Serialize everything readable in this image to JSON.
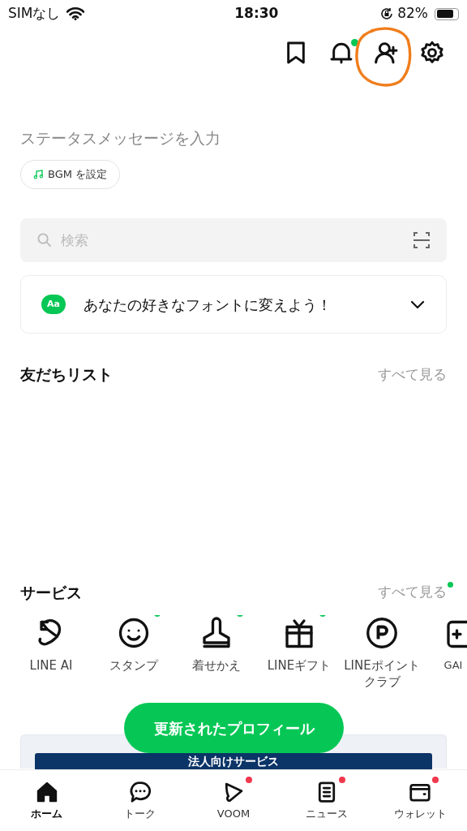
{
  "status_bar": {
    "carrier": "SIMなし",
    "time": "18:30",
    "battery": "82%"
  },
  "header_icons": [
    {
      "kind": "bookmark",
      "badge": false,
      "highlighted": false
    },
    {
      "kind": "bell",
      "badge": true,
      "highlighted": false
    },
    {
      "kind": "add-friend",
      "badge": false,
      "highlighted": true
    },
    {
      "kind": "settings",
      "badge": false,
      "highlighted": false
    }
  ],
  "profile": {
    "status_message_placeholder": "ステータスメッセージを入力",
    "bgm_button": "BGM を設定"
  },
  "search": {
    "placeholder": "検索"
  },
  "font_banner": {
    "icon_text": "Aa",
    "text": "あなたの好きなフォントに変えよう！",
    "expanded": false
  },
  "friends": {
    "title": "友だちリスト",
    "see_all": "すべて見る"
  },
  "services": {
    "title": "サービス",
    "see_all": "すべて見る",
    "see_all_badge": true,
    "items": [
      {
        "kind": "ai",
        "label": "LINE AI",
        "badge": false
      },
      {
        "kind": "sticker",
        "label": "スタンプ",
        "badge": true
      },
      {
        "kind": "theme",
        "label": "着せかえ",
        "badge": true
      },
      {
        "kind": "gift",
        "label": "LINEギフト",
        "badge": true
      },
      {
        "kind": "points",
        "label": "LINEポイントクラブ",
        "badge": false
      },
      {
        "kind": "games",
        "label": "GAI",
        "badge": false
      }
    ]
  },
  "floating_button": "更新されたプロフィール",
  "promo_banner": {
    "text": "法人向けサービス"
  },
  "tab_bar": [
    {
      "kind": "home",
      "label": "ホーム",
      "selected": true,
      "badge": false
    },
    {
      "kind": "talk",
      "label": "トーク",
      "selected": false,
      "badge": false
    },
    {
      "kind": "voom",
      "label": "VOOM",
      "selected": false,
      "badge": true
    },
    {
      "kind": "news",
      "label": "ニュース",
      "selected": false,
      "badge": true
    },
    {
      "kind": "wallet",
      "label": "ウォレット",
      "selected": false,
      "badge": true
    }
  ]
}
